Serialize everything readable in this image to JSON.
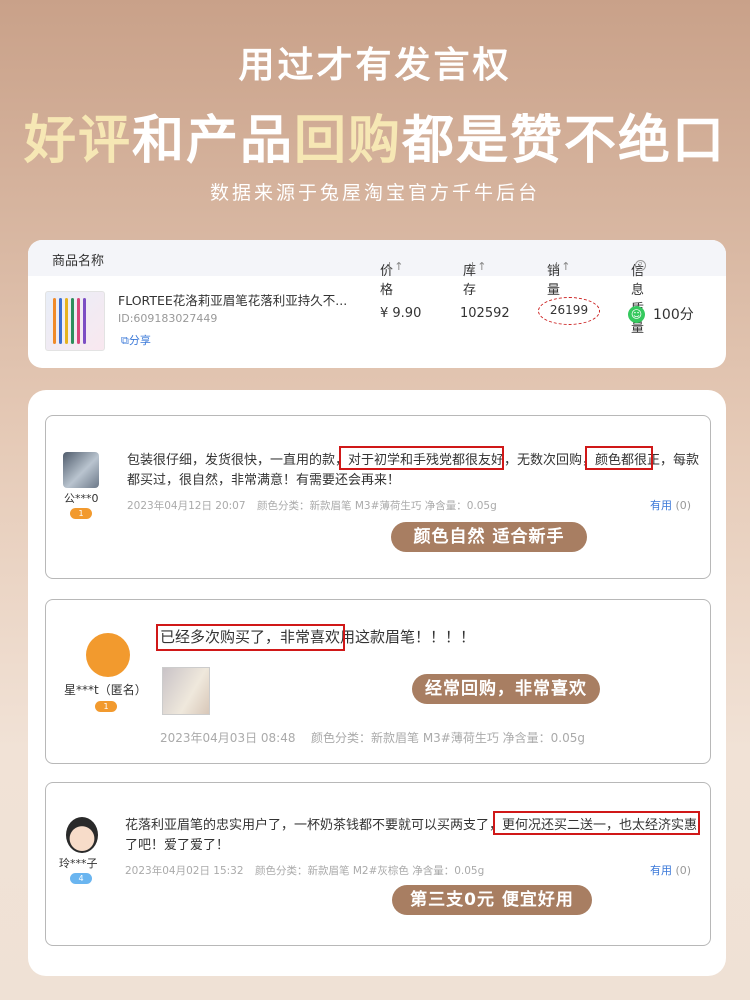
{
  "header": {
    "subtitle": "用过才有发言权",
    "main_parts": [
      "好评",
      "和产品",
      "回购",
      "都是赞不绝口"
    ],
    "source": "数据来源于兔屋淘宝官方千牛后台"
  },
  "product_table": {
    "columns": [
      "商品名称",
      "价格",
      "库存",
      "销量",
      "信息质量"
    ],
    "sort_icon": "↓↑",
    "help_icon": "?",
    "product": {
      "title": "FLORTEE花洛莉亚眉笔花落利亚持久不...",
      "id": "ID:609183027449",
      "share": "分享",
      "price": "¥ 9.90",
      "stock": "102592",
      "sales": "26199",
      "quality": "100分"
    }
  },
  "reviews": [
    {
      "user": "公***0",
      "level": "1",
      "text": "包装很仔细，发货很快，一直用的款，对于初学和手残党都很友好，无数次回购，颜色都很正，每款都买过，很自然，非常满意！有需要还会再来！",
      "highlight_1": "对于初学和手残党都很友好",
      "highlight_2": "颜色都很正",
      "date": "2023年04月12日 20:07",
      "spec": "颜色分类：新款眉笔 M3#薄荷生巧  净含量：0.05g",
      "useful": "有用",
      "useful_count": "(0)",
      "tag": "颜色自然 适合新手"
    },
    {
      "user": "星***t（匿名）",
      "level": "1",
      "text": "已经多次购买了，非常喜欢用这款眉笔！！！！",
      "highlight_1": "已经多次购买了，非常喜欢",
      "date": "2023年04月03日 08:48",
      "spec": "颜色分类：新款眉笔 M3#薄荷生巧  净含量：0.05g",
      "tag": "经常回购，非常喜欢"
    },
    {
      "user": "玲***子",
      "level": "4",
      "text": "花落利亚眉笔的忠实用户了，一杯奶茶钱都不要就可以买两支了，更何况还买二送一，也太经济实惠了吧！爱了爱了！",
      "highlight_1": "更何况还买二送一，也太经济实惠了",
      "date": "2023年04月02日 15:32",
      "spec": "颜色分类：新款眉笔 M2#灰棕色  净含量：0.05g",
      "useful": "有用",
      "useful_count": "(0)",
      "tag": "第三支0元 便宜好用"
    }
  ],
  "colors": {
    "highlight_border": "#d01818",
    "tag_bg": "#a87e62",
    "link_blue": "#3a78d8",
    "quality_green": "#35c95e"
  }
}
